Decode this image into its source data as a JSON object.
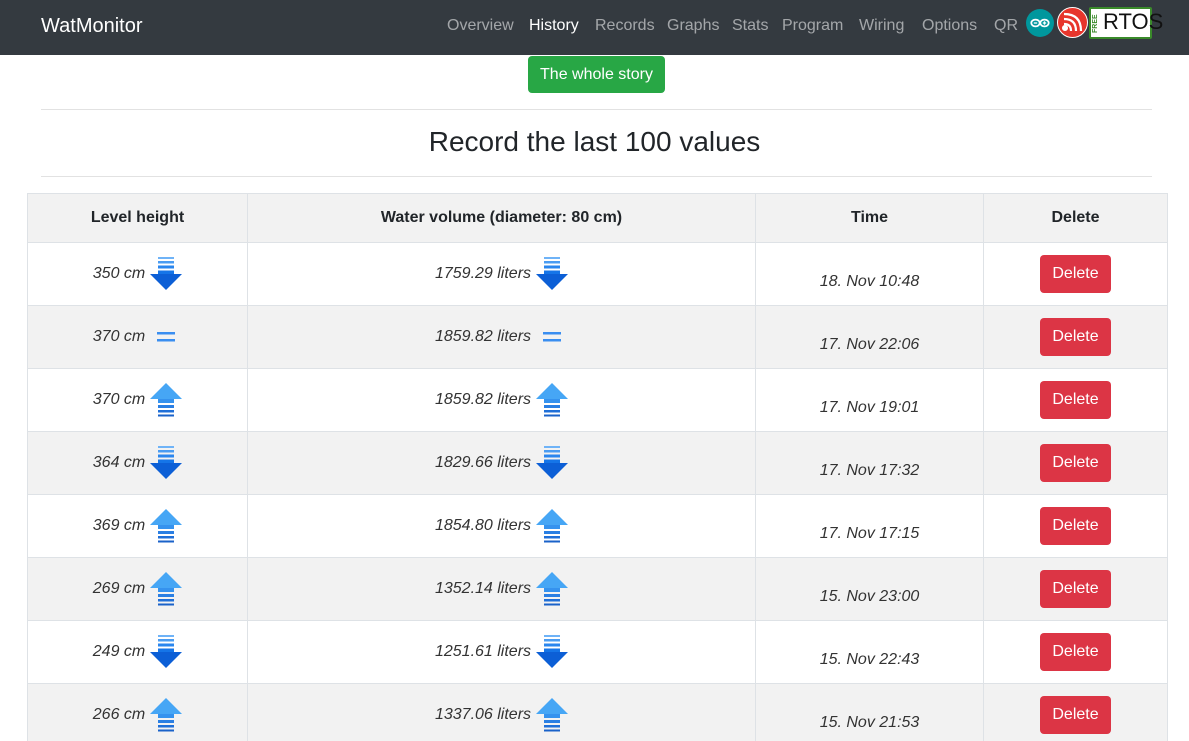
{
  "navbar": {
    "brand": "WatMonitor",
    "items": [
      {
        "label": "Overview",
        "active": false
      },
      {
        "label": "History",
        "active": true
      },
      {
        "label": "Records",
        "active": false
      },
      {
        "label": "Graphs",
        "active": false
      },
      {
        "label": "Stats",
        "active": false
      },
      {
        "label": "Program",
        "active": false
      },
      {
        "label": "Wiring",
        "active": false
      },
      {
        "label": "Options",
        "active": false
      },
      {
        "label": "QR",
        "active": false
      }
    ],
    "logos": {
      "arduino": "arduino-logo",
      "espressif": "espressif-logo",
      "freertos": "FREERTOS"
    },
    "freertos_small": "FREE",
    "freertos_big": "RTOS"
  },
  "story_button": "The whole story",
  "page_title": "Record the last 100 values",
  "table": {
    "headers": [
      "Level height",
      "Water volume (diameter: 80 cm)",
      "Time",
      "Delete"
    ],
    "rows": [
      {
        "level": "350 cm",
        "volume": "1759.29 liters",
        "time": "18. Nov 10:48",
        "trend": "down",
        "delete": "Delete"
      },
      {
        "level": "370 cm",
        "volume": "1859.82 liters",
        "time": "17. Nov 22:06",
        "trend": "equal",
        "delete": "Delete"
      },
      {
        "level": "370 cm",
        "volume": "1859.82 liters",
        "time": "17. Nov 19:01",
        "trend": "up",
        "delete": "Delete"
      },
      {
        "level": "364 cm",
        "volume": "1829.66 liters",
        "time": "17. Nov 17:32",
        "trend": "down",
        "delete": "Delete"
      },
      {
        "level": "369 cm",
        "volume": "1854.80 liters",
        "time": "17. Nov 17:15",
        "trend": "up",
        "delete": "Delete"
      },
      {
        "level": "269 cm",
        "volume": "1352.14 liters",
        "time": "15. Nov 23:00",
        "trend": "up",
        "delete": "Delete"
      },
      {
        "level": "249 cm",
        "volume": "1251.61 liters",
        "time": "15. Nov 22:43",
        "trend": "down",
        "delete": "Delete"
      },
      {
        "level": "266 cm",
        "volume": "1337.06 liters",
        "time": "15. Nov 21:53",
        "trend": "up",
        "delete": "Delete"
      }
    ]
  },
  "colors": {
    "navbar_bg": "#343a40",
    "success": "#28a745",
    "danger": "#dc3545",
    "arrow_down": "#0d6ef0",
    "arrow_up": "#3a9bf2"
  }
}
